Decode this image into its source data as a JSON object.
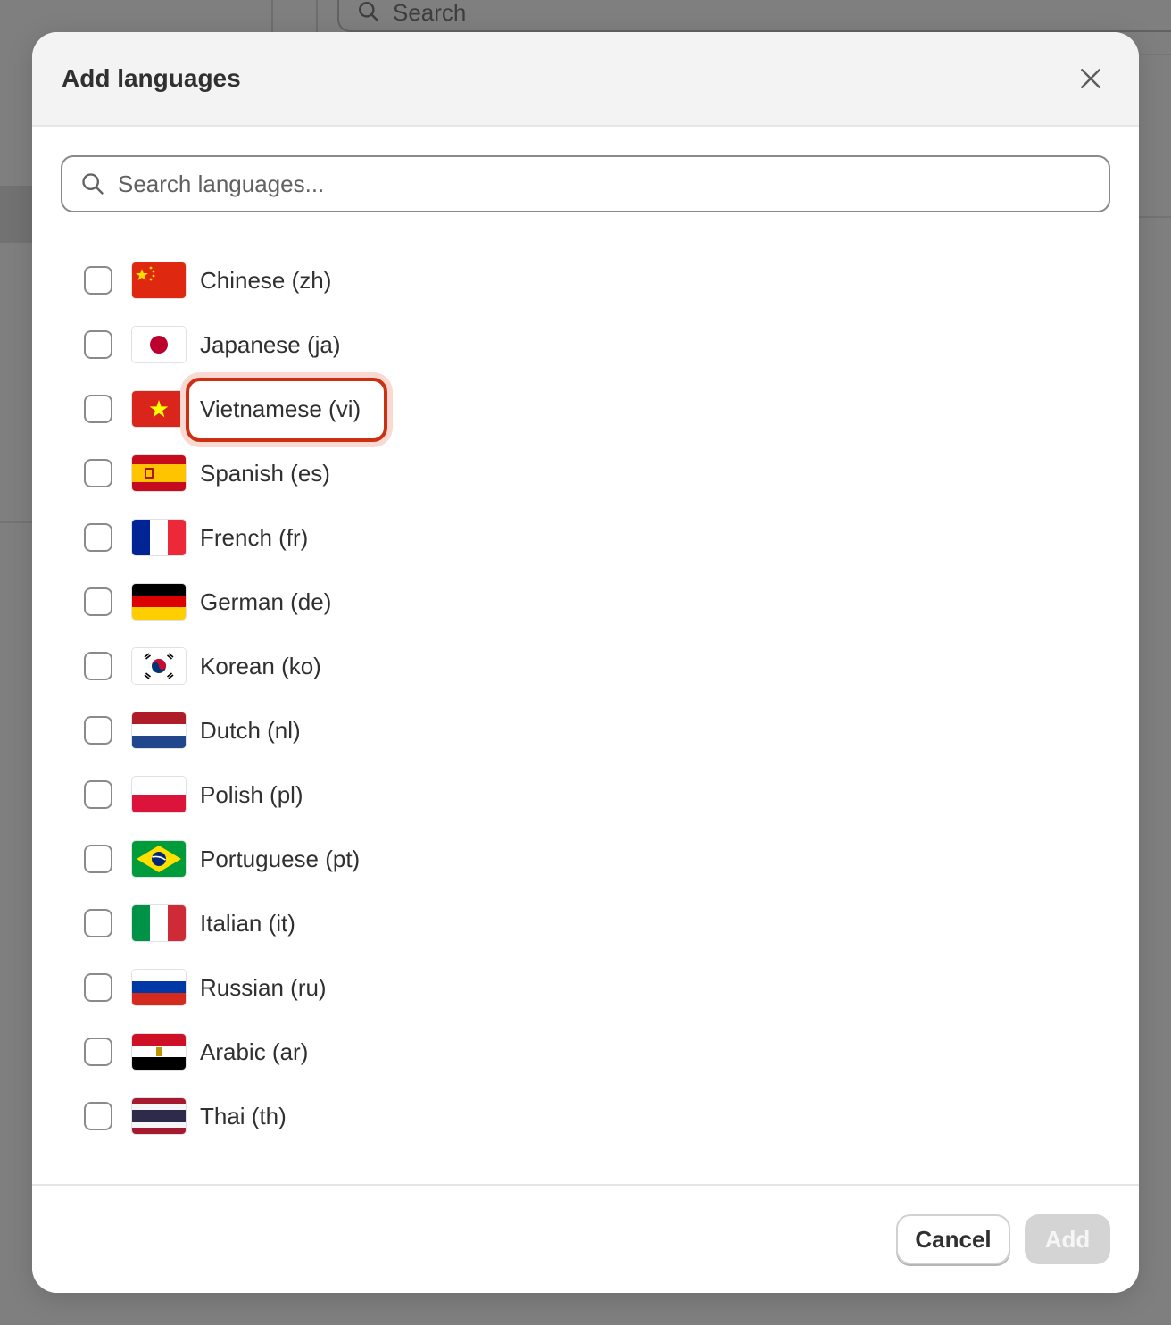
{
  "background": {
    "search_placeholder": "Search"
  },
  "modal": {
    "title": "Add languages",
    "search": {
      "placeholder": "Search languages...",
      "value": ""
    },
    "languages": [
      {
        "label": "Chinese (zh)",
        "flag": "flag-cn",
        "checked": false
      },
      {
        "label": "Japanese (ja)",
        "flag": "flag-jp",
        "checked": false
      },
      {
        "label": "Vietnamese (vi)",
        "flag": "flag-vn",
        "checked": false,
        "highlighted": true
      },
      {
        "label": "Spanish (es)",
        "flag": "flag-es",
        "checked": false
      },
      {
        "label": "French (fr)",
        "flag": "flag-fr",
        "checked": false
      },
      {
        "label": "German (de)",
        "flag": "flag-de",
        "checked": false
      },
      {
        "label": "Korean (ko)",
        "flag": "flag-kr",
        "checked": false
      },
      {
        "label": "Dutch (nl)",
        "flag": "flag-nl",
        "checked": false
      },
      {
        "label": "Polish (pl)",
        "flag": "flag-pl",
        "checked": false
      },
      {
        "label": "Portuguese (pt)",
        "flag": "flag-br",
        "checked": false
      },
      {
        "label": "Italian (it)",
        "flag": "flag-it",
        "checked": false
      },
      {
        "label": "Russian (ru)",
        "flag": "flag-ru",
        "checked": false
      },
      {
        "label": "Arabic (ar)",
        "flag": "flag-eg",
        "checked": false
      },
      {
        "label": "Thai (th)",
        "flag": "flag-th",
        "checked": false
      }
    ],
    "footer": {
      "cancel_label": "Cancel",
      "add_label": "Add",
      "add_disabled": true
    }
  },
  "colors": {
    "highlight": "#cc2f12",
    "overlay": "#7f7f7f"
  }
}
